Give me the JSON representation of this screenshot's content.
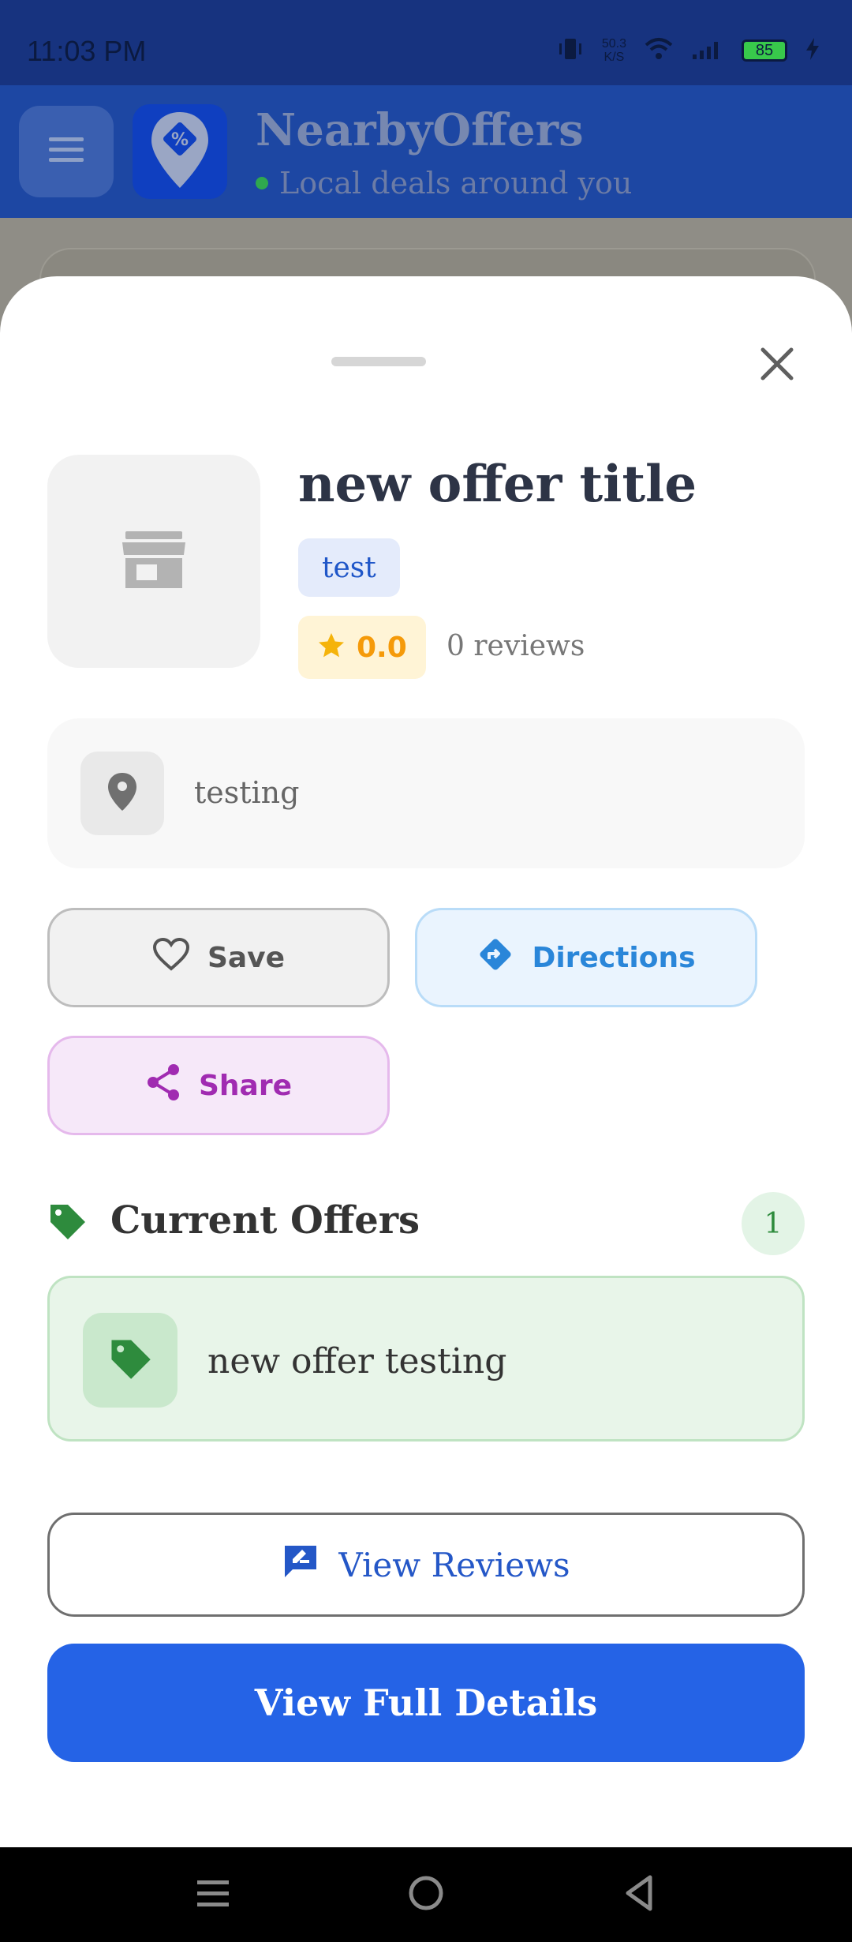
{
  "status_bar": {
    "time": "11:03 PM",
    "net_speed_value": "50.3",
    "net_speed_unit": "K/S",
    "battery": "85"
  },
  "app_bar": {
    "title": "NearbyOffers",
    "subtitle": "Local deals around you",
    "menu_icon": "hamburger-icon",
    "logo_icon": "location-discount-icon"
  },
  "sheet": {
    "offer_title": "new offer title",
    "category": "test",
    "rating": "0.0",
    "reviews_count": "0 reviews",
    "address": "testing",
    "buttons": {
      "save": "Save",
      "directions": "Directions",
      "share": "Share"
    },
    "current_offers": {
      "title": "Current Offers",
      "count": "1",
      "items": [
        {
          "text": "new offer testing"
        }
      ]
    },
    "view_reviews": "View Reviews",
    "view_full_details": "View Full Details"
  },
  "colors": {
    "primary": "#2563e6",
    "app_bar": "#1d47a3",
    "rating": "#f59a0a",
    "offers_green": "#2e8b3d",
    "share_purple": "#a02bb1",
    "directions_blue": "#2a86d9"
  }
}
